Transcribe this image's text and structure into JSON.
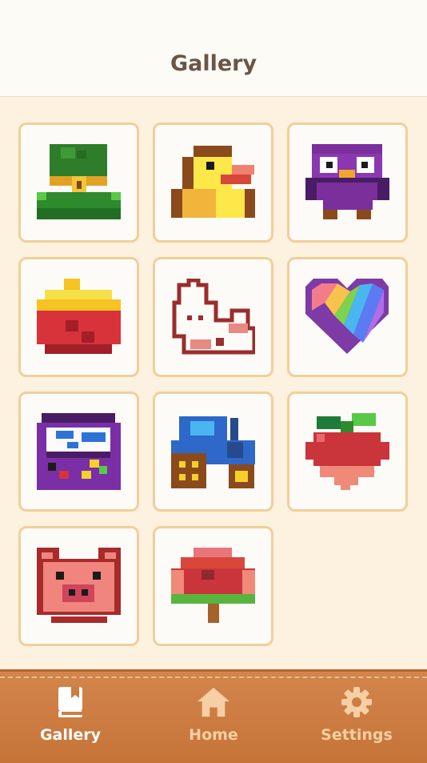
{
  "header": {
    "title": "Gallery"
  },
  "gallery": {
    "items": [
      {
        "name": "top-hat"
      },
      {
        "name": "duck"
      },
      {
        "name": "owl"
      },
      {
        "name": "box"
      },
      {
        "name": "rabbit"
      },
      {
        "name": "rainbow-heart"
      },
      {
        "name": "purple-chest"
      },
      {
        "name": "tractor"
      },
      {
        "name": "radish"
      },
      {
        "name": "pig"
      },
      {
        "name": "tree"
      }
    ]
  },
  "tabbar": {
    "tabs": [
      {
        "label": "Gallery",
        "icon": "book-icon",
        "active": true
      },
      {
        "label": "Home",
        "icon": "home-icon",
        "active": false
      },
      {
        "label": "Settings",
        "icon": "gear-icon",
        "active": false
      }
    ]
  },
  "colors": {
    "background": "#fdf1df",
    "header_bg": "#fdfbf6",
    "title": "#6b5544",
    "card_border": "#f1cf9b",
    "tabbar": "#cd7c42",
    "tab_active": "#ffffff",
    "tab_inactive": "#f6cfa4"
  }
}
